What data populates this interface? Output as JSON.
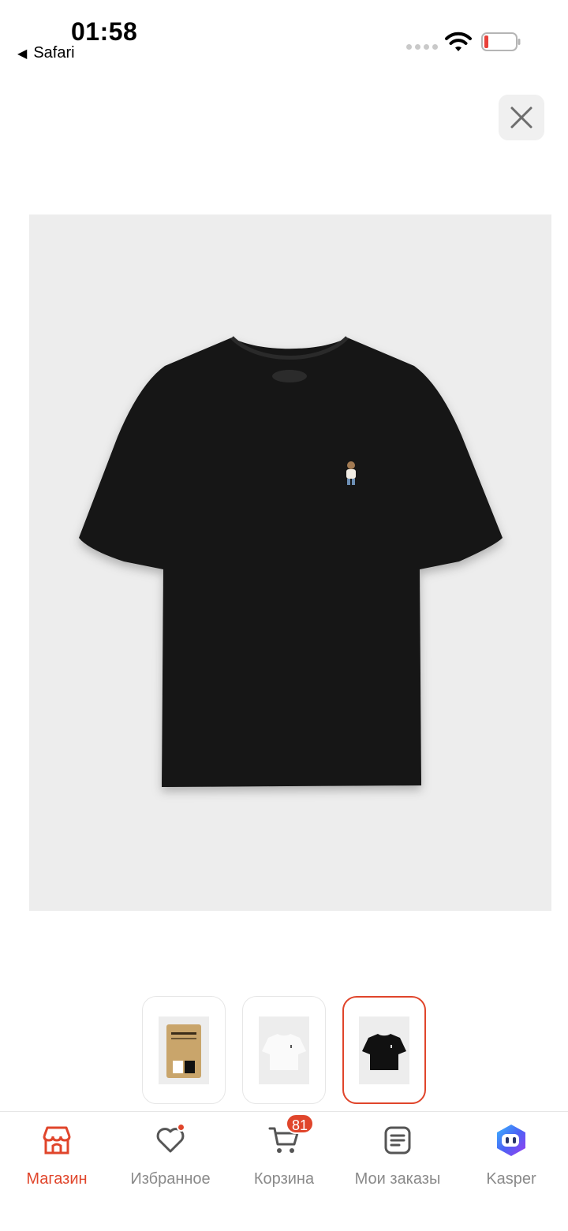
{
  "status_bar": {
    "time": "01:58",
    "back_app": "Safari"
  },
  "product": {
    "selected_thumbnail": 2,
    "thumbnails": [
      {
        "kind": "package-bag"
      },
      {
        "kind": "white-tshirt"
      },
      {
        "kind": "black-tshirt"
      }
    ]
  },
  "tab_bar": {
    "items": [
      {
        "label": "Магазин",
        "icon": "store-icon",
        "active": true
      },
      {
        "label": "Избранное",
        "icon": "heart-icon",
        "active": false
      },
      {
        "label": "Корзина",
        "icon": "cart-icon",
        "active": false,
        "badge": "81"
      },
      {
        "label": "Мои заказы",
        "icon": "orders-icon",
        "active": false
      },
      {
        "label": "Kasper",
        "icon": "kasper-icon",
        "active": false
      }
    ]
  },
  "colors": {
    "accent": "#e0452b",
    "inactive": "#8a8a8a",
    "image_bg": "#ededed"
  }
}
